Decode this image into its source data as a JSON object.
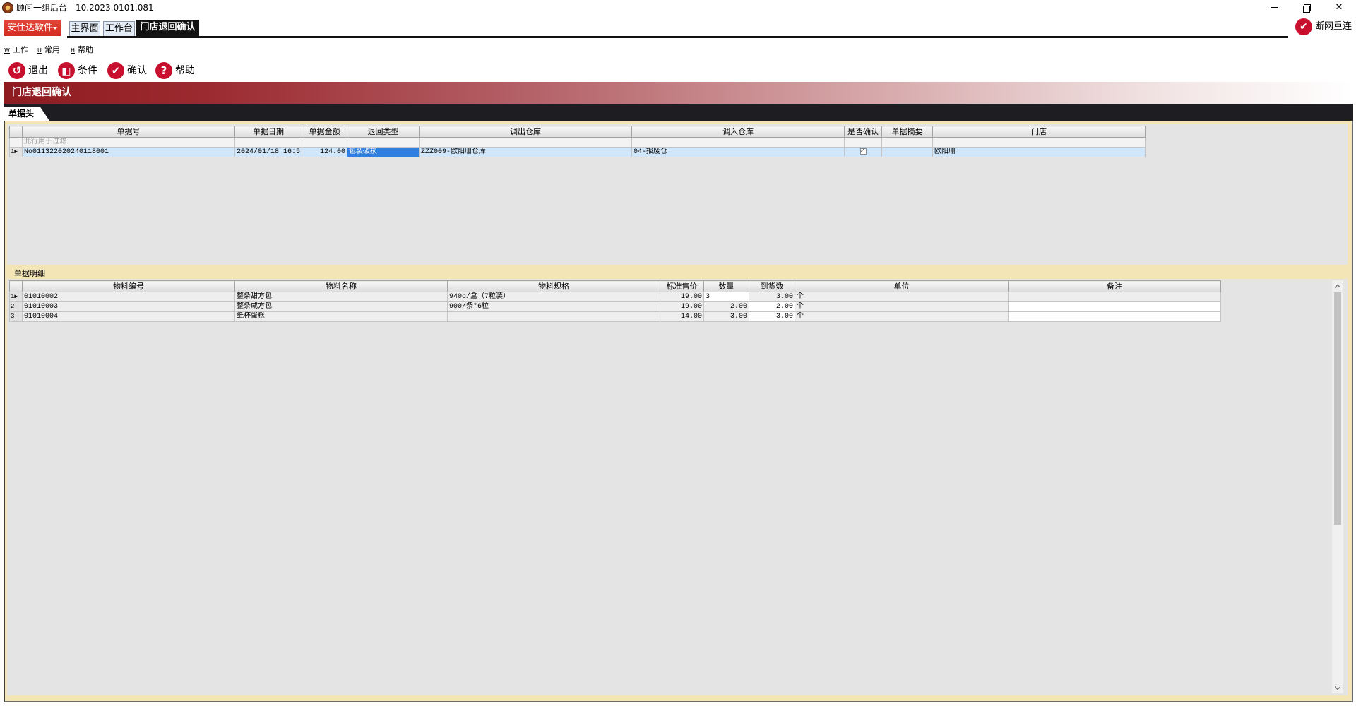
{
  "window": {
    "app_title": "顾问一组后台",
    "version": "10.2023.0101.081",
    "icons": {
      "app": "app-logo-icon",
      "minimize": "minimize-icon",
      "restore": "restore-icon",
      "close": "close-icon"
    }
  },
  "topbar": {
    "brand_label": "安仕达软件",
    "tabs": [
      {
        "label": "主界面",
        "active": false
      },
      {
        "label": "工作台",
        "active": false
      },
      {
        "label": "门店退回确认",
        "active": true
      }
    ],
    "reconnect": {
      "label": "断网重连",
      "icon": "check-circle-icon"
    }
  },
  "menu": [
    {
      "hotkey": "W",
      "label": "工作"
    },
    {
      "hotkey": "U",
      "label": "常用"
    },
    {
      "hotkey": "H",
      "label": "帮助"
    }
  ],
  "toolbar": [
    {
      "label": "退出",
      "icon": "exit-icon"
    },
    {
      "label": "条件",
      "icon": "filter-icon"
    },
    {
      "label": "确认",
      "icon": "confirm-icon"
    },
    {
      "label": "帮助",
      "icon": "help-icon"
    }
  ],
  "banner": {
    "title": "门店退回确认"
  },
  "header_section": {
    "tab_label": "单据头",
    "columns": [
      "单据号",
      "单据日期",
      "单据金额",
      "退回类型",
      "调出仓库",
      "调入仓库",
      "是否确认",
      "单据摘要",
      "门店"
    ],
    "filter_placeholder": "此行用于过滤",
    "rows": [
      {
        "row_no": "1",
        "doc_no": "No011322020240118001",
        "date": "2024/01/18 16:5",
        "amount": "124.00",
        "return_type": "包装破损",
        "out_warehouse": "ZZZ009-欧阳珊仓库",
        "in_warehouse": "04-报废仓",
        "confirmed": true,
        "store": "欧阳珊"
      }
    ]
  },
  "detail_section": {
    "group_label": "单据明细",
    "columns": [
      "物料编号",
      "物料名称",
      "物料规格",
      "标准售价",
      "数量",
      "到货数",
      "单位",
      "备注"
    ],
    "rows": [
      {
        "row_no": "1",
        "code": "01010002",
        "name": "整条甜方包",
        "spec": "940g/盒（7粒装）",
        "price": "19.00",
        "qty": "3",
        "received": "3.00",
        "unit": "个"
      },
      {
        "row_no": "2",
        "code": "01010003",
        "name": "整条咸方包",
        "spec": "900/条*6粒",
        "price": "19.00",
        "qty": "2.00",
        "received": "2.00",
        "unit": "个"
      },
      {
        "row_no": "3",
        "code": "01010004",
        "name": "纸杯蛋糕",
        "price": "14.00",
        "qty": "3.00",
        "received": "3.00",
        "unit": "个"
      }
    ]
  },
  "colors": {
    "brand_red": "#d42a20",
    "banner_red": "#8e1b1f",
    "icon_red": "#c8102e",
    "selection_blue": "#2f7fe0",
    "selected_row": "#cfe6fb",
    "panel_frame": "#f3e5b6",
    "dark_strip": "#1d1d22"
  }
}
